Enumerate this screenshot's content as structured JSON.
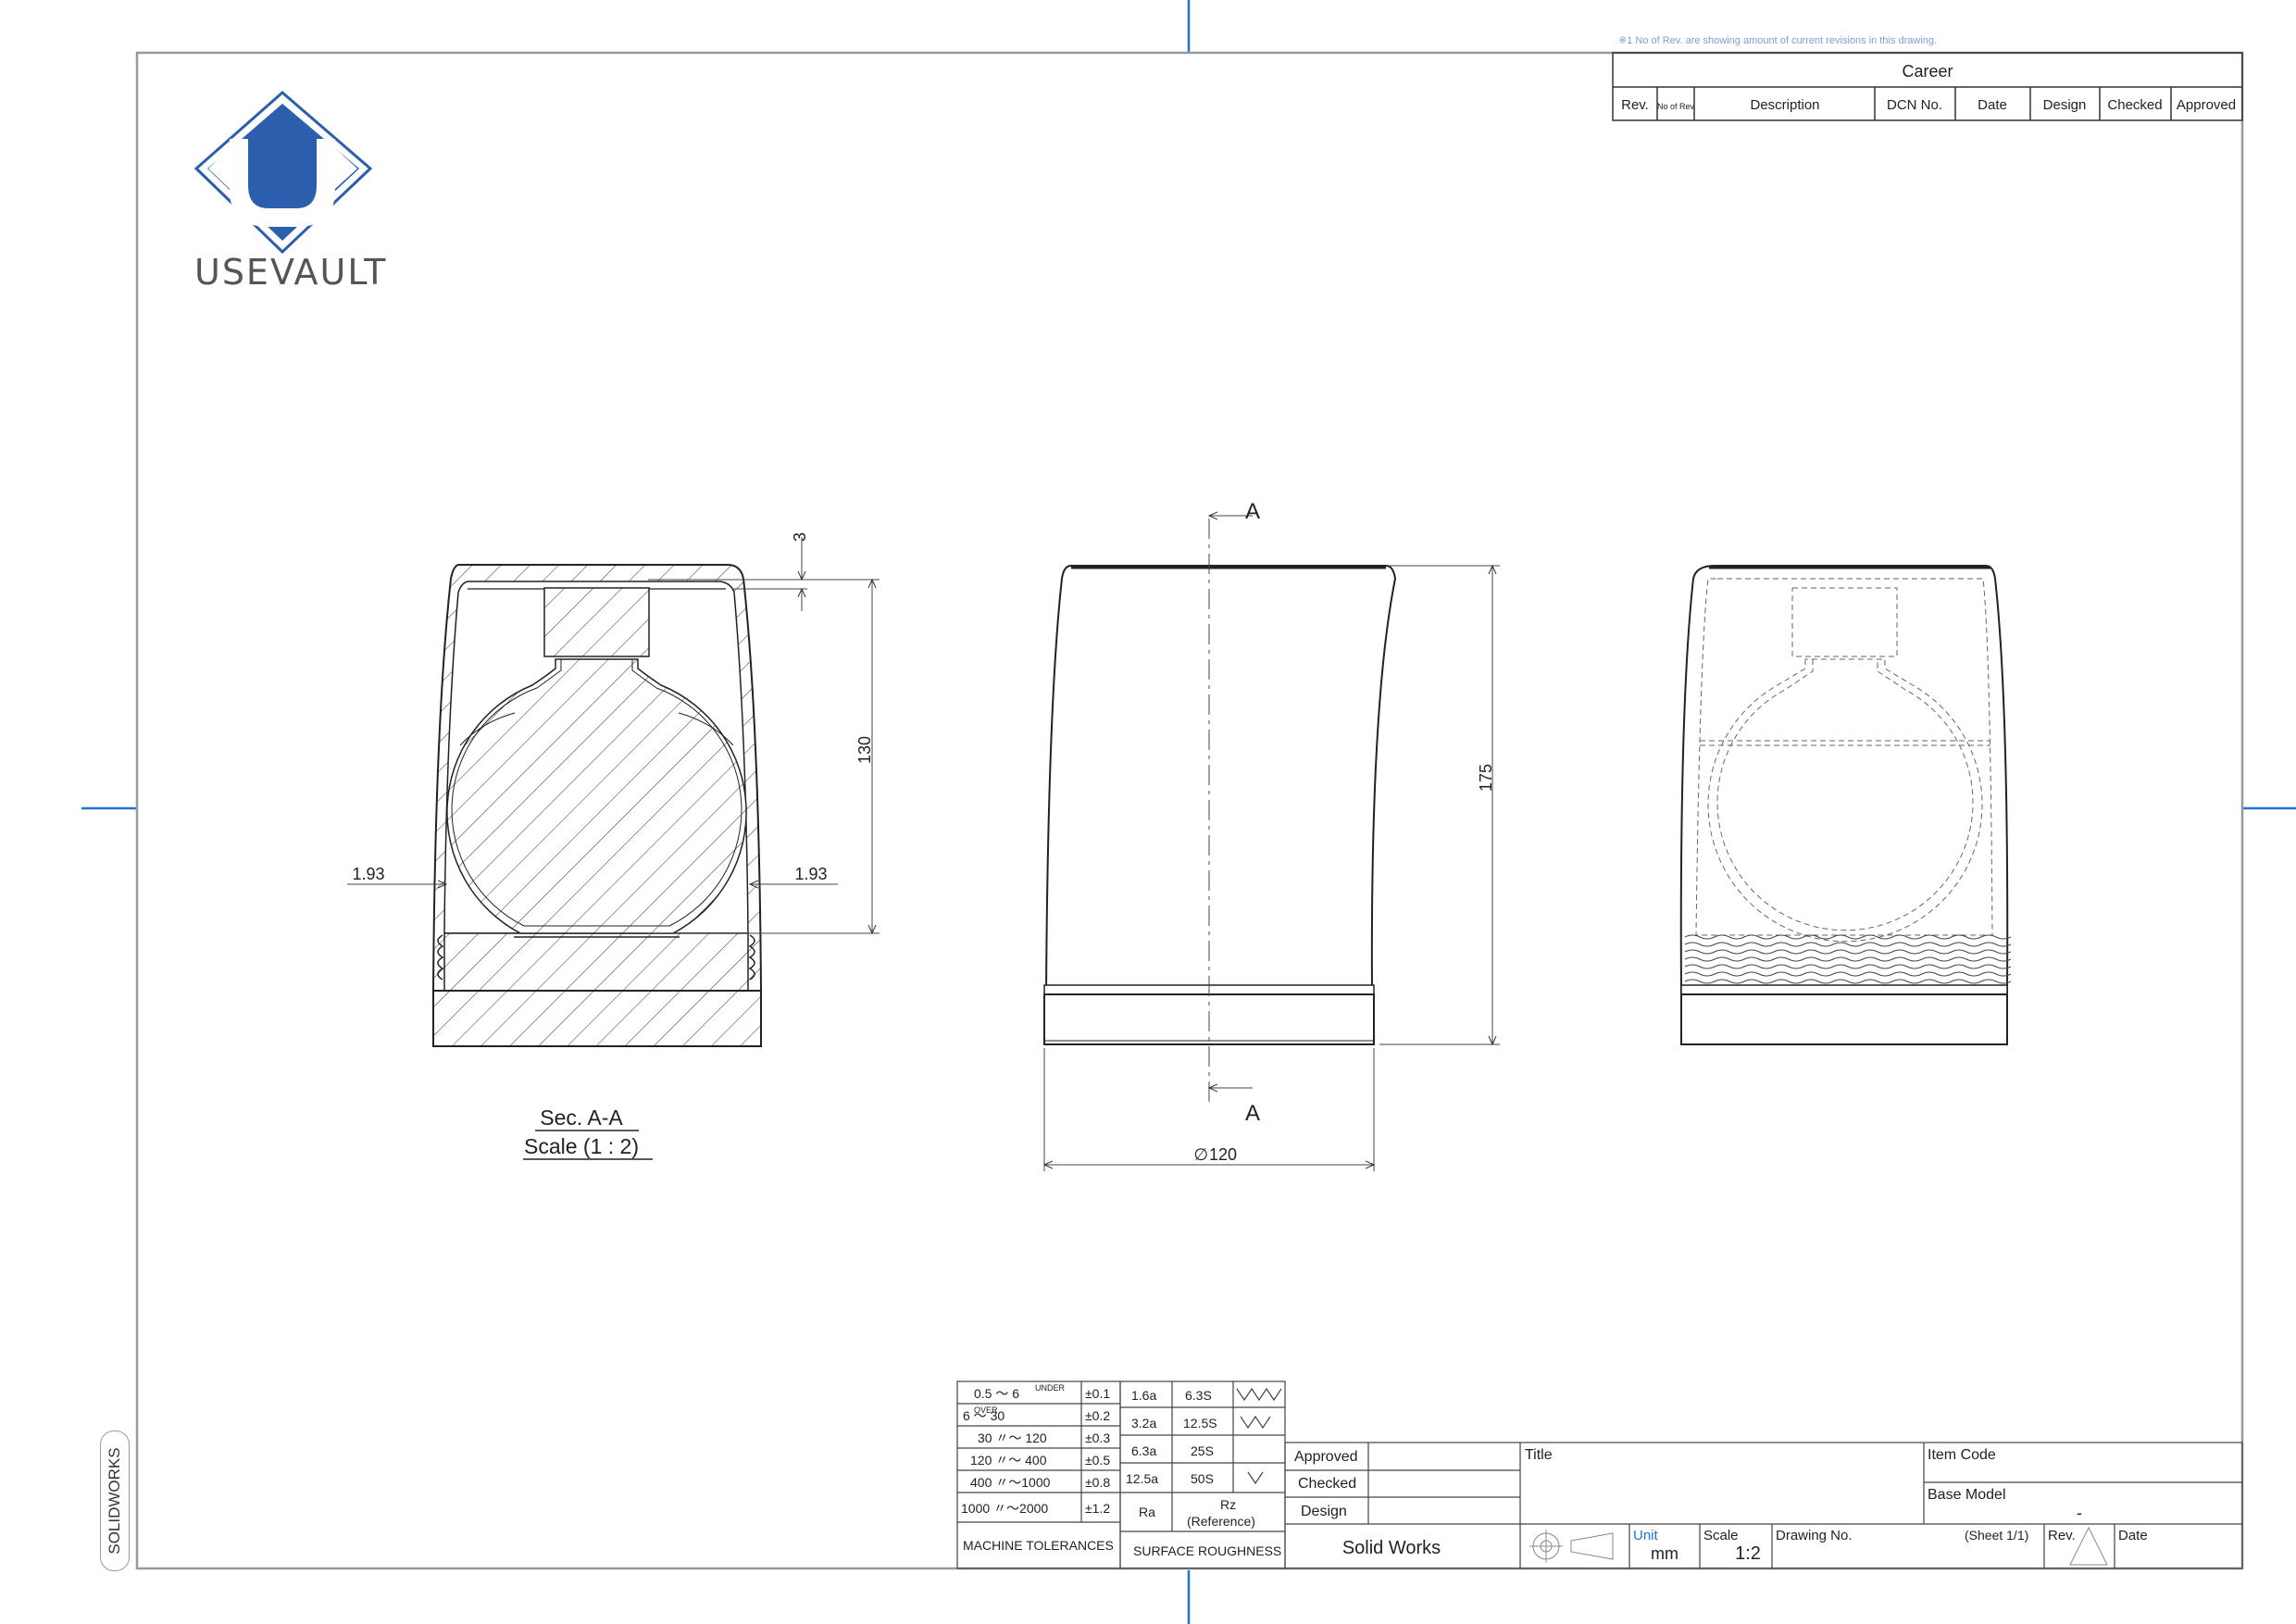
{
  "note": "※1  No of Rev. are showing amount of current revisions in this drawing.",
  "logo": {
    "text": "USEVAULT",
    "color": "#2b5fad"
  },
  "revision_table": {
    "title": "Career",
    "headers": [
      "Rev.",
      "No of Rev",
      "Description",
      "DCN No.",
      "Date",
      "Design",
      "Checked",
      "Approved"
    ]
  },
  "views": {
    "section": {
      "title": "Sec. A-A",
      "scale": "Scale (1 : 2)",
      "dims": {
        "top": "3",
        "height": "130",
        "wall_left": "1.93",
        "wall_right": "1.93"
      }
    },
    "front": {
      "dims": {
        "height": "175",
        "diameter": "120"
      },
      "cut_label_top": "A",
      "cut_label_bottom": "A",
      "diameter_symbol": "∅"
    }
  },
  "tolerances": {
    "title": "MACHINE TOLERANCES",
    "rows": [
      {
        "range": "0.5 〜 6",
        "sup": "UNDER",
        "tol": "±0.1"
      },
      {
        "range": "6    〜   30",
        "sup": "OVER",
        "tol": "±0.2"
      },
      {
        "range": "30 〃〜 120",
        "sup": "",
        "tol": "±0.3"
      },
      {
        "range": "120 〃〜 400",
        "sup": "",
        "tol": "±0.5"
      },
      {
        "range": "400 〃〜1000",
        "sup": "",
        "tol": "±0.8"
      },
      {
        "range": "1000 〃〜2000",
        "sup": "",
        "tol": "±1.2"
      }
    ]
  },
  "roughness": {
    "title": "SURFACE ROUGHNESS",
    "rows": [
      {
        "ra": "1.6a",
        "rz": "6.3S"
      },
      {
        "ra": "3.2a",
        "rz": "12.5S"
      },
      {
        "ra": "6.3a",
        "rz": "25S"
      },
      {
        "ra": "12.5a",
        "rz": "50S"
      }
    ],
    "ra_label": "Ra",
    "rz_label": "Rz",
    "rz_sub": "(Reference)"
  },
  "title_block": {
    "approved": "Approved",
    "checked": "Checked",
    "design": "Design",
    "software": "Solid  Works",
    "title_label": "Title",
    "item_code_label": "Item Code",
    "base_model_label": "Base Model",
    "base_model_value": "-",
    "unit_label": "Unit",
    "unit_value": "mm",
    "scale_label": "Scale",
    "scale_value": "1:2",
    "drawing_no_label": "Drawing No.",
    "sheet": "(Sheet 1/1)",
    "rev_label": "Rev.",
    "date_label": "Date"
  },
  "software_tab": "SOLIDWORKS",
  "colors": {
    "marker": "#1e73d2",
    "line": "#222222",
    "note": "#7a9fd8"
  }
}
